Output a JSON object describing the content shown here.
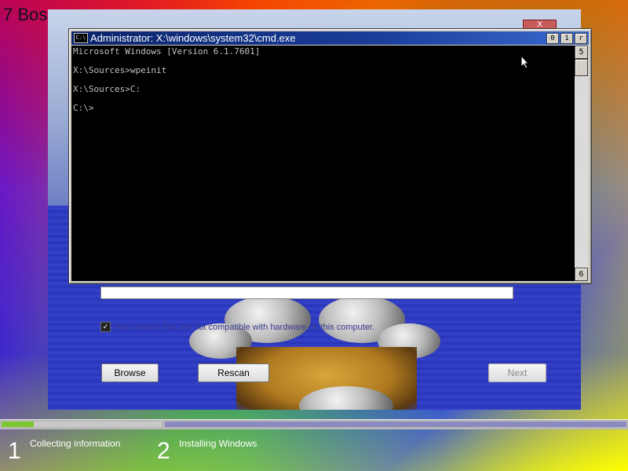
{
  "desktop": {
    "title": "7 Bos"
  },
  "setup_window": {
    "close_label": "X",
    "hide_drivers_label": "Hide drivers that are not compatible with hardware on this computer.",
    "buttons": {
      "browse": "Browse",
      "rescan": "Rescan",
      "next": "Next"
    }
  },
  "cmd_window": {
    "title": "Administrator: X:\\windows\\system32\\cmd.exe",
    "icon_text": "C:\\",
    "controls": {
      "minimize": "0",
      "maximize": "1",
      "close": "r"
    },
    "lines": [
      "Microsoft Windows [Version 6.1.7601]",
      "",
      "X:\\Sources>wpeinit",
      "",
      "X:\\Sources>C:",
      "",
      "C:\\>"
    ],
    "scroll_up": "5",
    "scroll_down": "6"
  },
  "progress": {
    "fraction": 0.2
  },
  "steps": [
    {
      "number": "1",
      "label": "Collecting information"
    },
    {
      "number": "2",
      "label": "Installing Windows"
    }
  ]
}
